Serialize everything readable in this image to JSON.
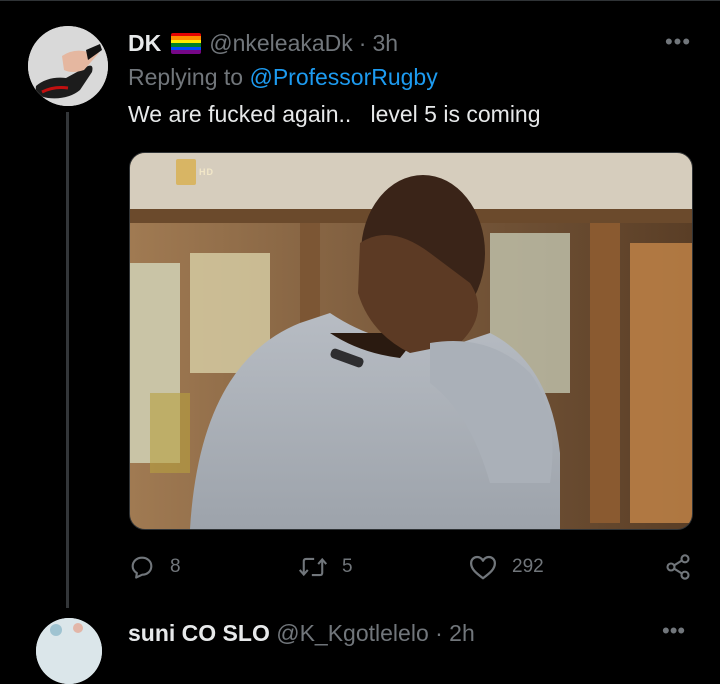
{
  "tweet": {
    "display_name": "DK",
    "flag_colors": [
      "#e40303",
      "#ff8c00",
      "#ffed00",
      "#008026",
      "#004dff",
      "#750787"
    ],
    "handle": "@nkeleakaDk",
    "separator": "·",
    "time": "3h",
    "more_label": "•••",
    "replying_to_prefix": "Replying to ",
    "replying_to_user": "@ProfessorRugby",
    "text": "We are fucked again..   level 5 is coming",
    "media_watermark": "HD",
    "reply_count": "8",
    "retweet_count": "5",
    "like_count": "292"
  },
  "next_tweet": {
    "display_name": "suni CO SLO",
    "meta": " @K_Kgotlelelo · 2h",
    "more_label": "•••"
  },
  "colors": {
    "background": "#000000",
    "text": "#e7e9ea",
    "muted": "#71767b",
    "link": "#1d9bf0",
    "divider": "#2f3336"
  },
  "icons": [
    "reply-icon",
    "retweet-icon",
    "like-icon",
    "share-icon",
    "more-icon"
  ]
}
